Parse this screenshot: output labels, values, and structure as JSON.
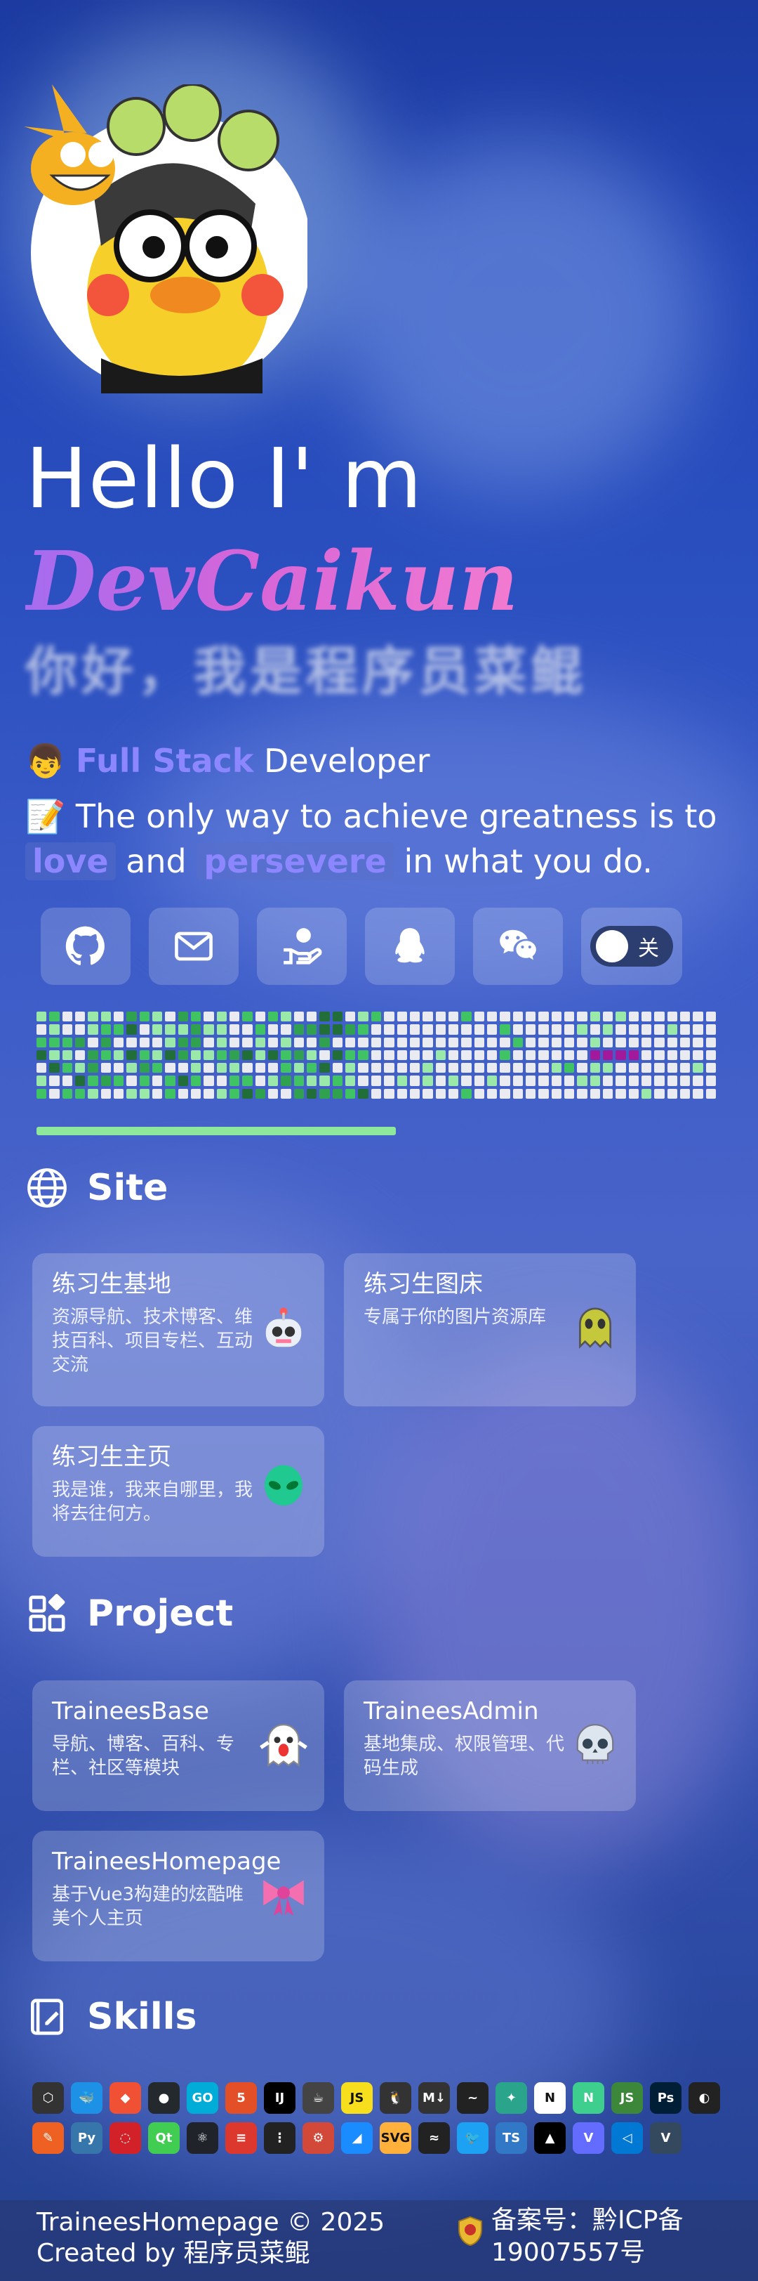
{
  "hero": {
    "greeting": "Hello I' m",
    "name": "DevCaikun",
    "cn_greeting": "你好，我是程序员菜鲲",
    "role_emoji": "👦",
    "role_highlight": "Full Stack",
    "role_rest": "Developer",
    "quote_emoji": "📝",
    "quote_start": "The only way to achieve greatness is to",
    "tag1": "love",
    "word_and": "and",
    "tag2": "persevere",
    "quote_end": "in what you do."
  },
  "social": {
    "icons": [
      "github-icon",
      "mail-icon",
      "donate-icon",
      "qq-icon",
      "wechat-icon"
    ],
    "toggle_label": "关"
  },
  "colors": {
    "accent": "#8c86ff",
    "brand_gradient": [
      "#a56cf0",
      "#f27bd0"
    ],
    "contribution": [
      "#e9ebf0",
      "#9be9a8",
      "#40c463",
      "#30a14e",
      "#216e39"
    ]
  },
  "site": {
    "title": "Site",
    "cards": [
      {
        "title": "练习生基地",
        "desc": "资源导航、技术博客、维技百科、项目专栏、互动交流",
        "icon": "robot-icon"
      },
      {
        "title": "练习生图床",
        "desc": "专属于你的图片资源库",
        "icon": "ghost-icon"
      },
      {
        "title": "练习生主页",
        "desc": "我是谁，我来自哪里，我将去往何方。",
        "icon": "alien-icon"
      }
    ]
  },
  "project": {
    "title": "Project",
    "cards": [
      {
        "title": "TraineesBase",
        "desc": "导航、博客、百科、专栏、社区等模块",
        "icon": "ghost-icon"
      },
      {
        "title": "TraineesAdmin",
        "desc": "基地集成、权限管理、代码生成",
        "icon": "skull-icon"
      },
      {
        "title": "TraineesHomepage",
        "desc": "基于Vue3构建的炫酷唯美个人主页",
        "icon": "bow-icon"
      }
    ]
  },
  "skills": {
    "title": "Skills",
    "row1": [
      {
        "label": "⬡",
        "color": "#333"
      },
      {
        "label": "🐳",
        "color": "#1d91e6"
      },
      {
        "label": "◆",
        "color": "#f05033"
      },
      {
        "label": "●",
        "color": "#24292e"
      },
      {
        "label": "GO",
        "color": "#00add8"
      },
      {
        "label": "5",
        "color": "#e34f26"
      },
      {
        "label": "IJ",
        "color": "#000"
      },
      {
        "label": "☕",
        "color": "#444"
      },
      {
        "label": "JS",
        "color": "#f7df1e"
      },
      {
        "label": "🐧",
        "color": "#333"
      },
      {
        "label": "M↓",
        "color": "#333"
      },
      {
        "label": "~",
        "color": "#222"
      },
      {
        "label": "✦",
        "color": "#2aa58c"
      },
      {
        "label": "N",
        "color": "#fff"
      },
      {
        "label": "N",
        "color": "#3ecf8e"
      },
      {
        "label": "JS",
        "color": "#3c873a"
      },
      {
        "label": "Ps",
        "color": "#001e36"
      },
      {
        "label": "◐",
        "color": "#222"
      }
    ],
    "row2": [
      {
        "label": "✎",
        "color": "#ee6123"
      },
      {
        "label": "Py",
        "color": "#3776ab"
      },
      {
        "label": "◌",
        "color": "#d22128"
      },
      {
        "label": "Qt",
        "color": "#41cd52"
      },
      {
        "label": "⚛",
        "color": "#20232a"
      },
      {
        "label": "≡",
        "color": "#dc382d"
      },
      {
        "label": "⋮",
        "color": "#222"
      },
      {
        "label": "⚙",
        "color": "#d24939"
      },
      {
        "label": "◢",
        "color": "#1a8cff"
      },
      {
        "label": "SVG",
        "color": "#ffb13b"
      },
      {
        "label": "≈",
        "color": "#222"
      },
      {
        "label": "🐦",
        "color": "#1da1f2"
      },
      {
        "label": "TS",
        "color": "#3178c6"
      },
      {
        "label": "▲",
        "color": "#000"
      },
      {
        "label": "V",
        "color": "#646cff"
      },
      {
        "label": "◁",
        "color": "#0078d4"
      },
      {
        "label": "V",
        "color": "#35495e"
      }
    ]
  },
  "footer": {
    "line1": "TraineesHomepage © 2025",
    "line2": "Created by 程序员菜鲲",
    "icp_line1": "备案号：黔ICP备",
    "icp_line2": "19007557号"
  }
}
